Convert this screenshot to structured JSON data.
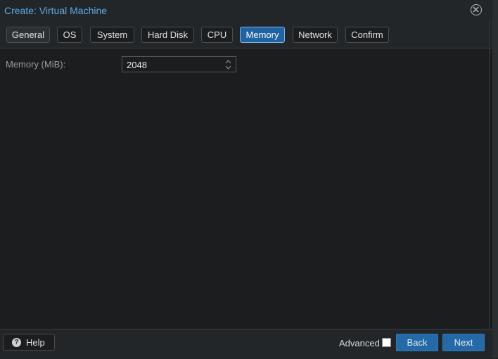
{
  "window": {
    "title": "Create: Virtual Machine"
  },
  "tabs": [
    {
      "label": "General",
      "active": false
    },
    {
      "label": "OS",
      "active": false
    },
    {
      "label": "System",
      "active": false
    },
    {
      "label": "Hard Disk",
      "active": false
    },
    {
      "label": "CPU",
      "active": false
    },
    {
      "label": "Memory",
      "active": true
    },
    {
      "label": "Network",
      "active": false
    },
    {
      "label": "Confirm",
      "active": false
    }
  ],
  "form": {
    "memory_label": "Memory (MiB):",
    "memory_value": "2048"
  },
  "footer": {
    "help_label": "Help",
    "advanced_label": "Advanced",
    "advanced_checked": false,
    "back_label": "Back",
    "next_label": "Next"
  },
  "icons": {
    "close": "close-circle-icon",
    "help": "question-circle-icon",
    "spinner": "up-down-chevron-icon"
  },
  "colors": {
    "accent": "#1f63a3",
    "title": "#5ea8e6",
    "background": "#1b1d1f"
  }
}
